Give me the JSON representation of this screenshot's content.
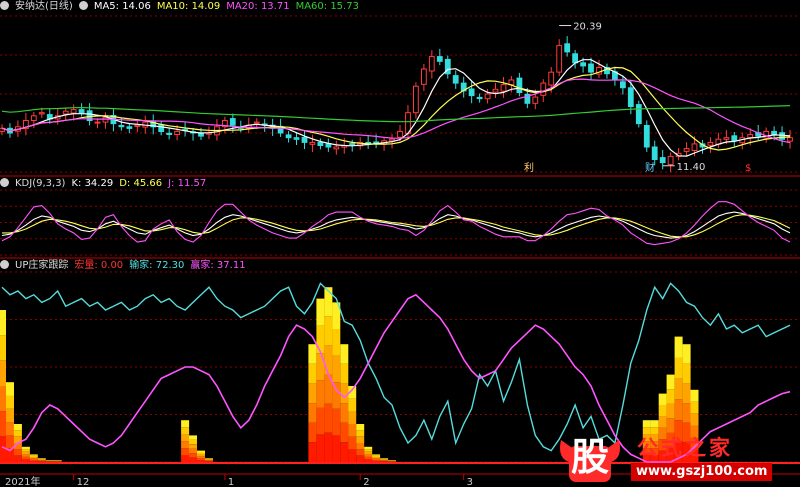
{
  "panel1": {
    "stock_name": "安纳达(日线)",
    "ma5": {
      "label": "MA5: 14.06",
      "color": "#ffffff"
    },
    "ma10": {
      "label": "MA10: 14.09",
      "color": "#ffff55"
    },
    "ma20": {
      "label": "MA20: 13.71",
      "color": "#ff55ff"
    },
    "ma60": {
      "label": "MA60: 15.73",
      "color": "#33cc33"
    },
    "high_label": "20.39",
    "low_label": "11.40",
    "events": [
      {
        "text": "利",
        "color": "#ffcc66"
      },
      {
        "text": "财",
        "color": "#66ccff"
      },
      {
        "text": "$",
        "color": "#ff3333"
      }
    ]
  },
  "panel2": {
    "indicator": "KDJ(9,3,3)",
    "k": {
      "label": "K: 34.29",
      "color": "#ffffff"
    },
    "d": {
      "label": "D: 45.66",
      "color": "#ffff55"
    },
    "j": {
      "label": "J: 11.57",
      "color": "#ff55ff"
    }
  },
  "panel3": {
    "indicator": "UP庄家跟踪",
    "s1": {
      "label": "宏量: 0.00",
      "color": "#ff3333"
    },
    "s2": {
      "label": "输家: 72.30",
      "color": "#55dddd"
    },
    "s3": {
      "label": "赢家: 37.11",
      "color": "#ff55ff"
    }
  },
  "xaxis": {
    "ticks": [
      {
        "label": "2021年",
        "bar": 0
      },
      {
        "label": "12",
        "bar": 9
      },
      {
        "label": "1",
        "bar": 28
      },
      {
        "label": "2",
        "bar": 45
      },
      {
        "label": "3",
        "bar": 58
      }
    ]
  },
  "watermark": {
    "logo_char": "股",
    "title": "公式之家",
    "url": "www.gszj100.com"
  },
  "chart_data": [
    {
      "type": "candlestick",
      "title": "安纳达(日线)",
      "y_range": [
        11.0,
        21.0
      ],
      "close": [
        13.8,
        13.5,
        13.9,
        14.3,
        14.6,
        14.8,
        14.4,
        14.6,
        14.9,
        15.0,
        14.8,
        14.3,
        14.2,
        14.5,
        14.1,
        13.9,
        13.8,
        14.0,
        14.2,
        13.9,
        13.6,
        13.4,
        13.6,
        13.7,
        13.5,
        13.3,
        13.5,
        13.9,
        14.3,
        14.0,
        13.8,
        14.0,
        14.2,
        14.0,
        13.8,
        13.5,
        13.2,
        13.1,
        12.9,
        12.9,
        12.7,
        12.6,
        12.6,
        12.7,
        12.8,
        12.9,
        12.8,
        12.9,
        13.0,
        13.1,
        13.6,
        14.8,
        16.5,
        17.6,
        18.4,
        18.1,
        17.3,
        16.7,
        16.2,
        15.9,
        15.7,
        16.0,
        16.3,
        16.6,
        16.9,
        16.1,
        15.4,
        15.8,
        16.7,
        17.4,
        19.1,
        18.7,
        18.0,
        17.8,
        17.4,
        17.7,
        17.3,
        16.9,
        16.4,
        15.2,
        14.1,
        12.6,
        11.8,
        11.6,
        12.0,
        12.2,
        12.5,
        12.8,
        12.6,
        12.9,
        13.1,
        13.2,
        13.0,
        13.2,
        13.4,
        13.3,
        13.6,
        13.4,
        13.1,
        13.2
      ],
      "high": 20.39,
      "low": 11.4
    },
    {
      "type": "line",
      "title": "KDJ(9,3,3)",
      "y_range": [
        0,
        100
      ],
      "series": [
        {
          "name": "K",
          "values": [
            30,
            32,
            38,
            46,
            55,
            60,
            58,
            52,
            48,
            44,
            38,
            36,
            40,
            48,
            52,
            46,
            40,
            34,
            32,
            38,
            42,
            46,
            40,
            34,
            30,
            32,
            40,
            50,
            58,
            62,
            60,
            56,
            52,
            48,
            44,
            40,
            36,
            34,
            36,
            40,
            44,
            50,
            54,
            56,
            58,
            56,
            54,
            52,
            50,
            48,
            46,
            44,
            40,
            42,
            48,
            56,
            62,
            60,
            56,
            54,
            50,
            46,
            42,
            38,
            36,
            34,
            30,
            28,
            30,
            34,
            40,
            46,
            50,
            54,
            58,
            60,
            58,
            56,
            52,
            46,
            40,
            34,
            30,
            28,
            26,
            27,
            30,
            36,
            44,
            52,
            60,
            64,
            66,
            64,
            60,
            56,
            52,
            48,
            40,
            34
          ]
        },
        {
          "name": "D",
          "values": [
            34,
            34,
            36,
            40,
            46,
            52,
            55,
            54,
            52,
            49,
            45,
            41,
            40,
            43,
            47,
            47,
            45,
            41,
            37,
            37,
            39,
            42,
            42,
            39,
            35,
            33,
            35,
            41,
            48,
            54,
            57,
            57,
            55,
            52,
            49,
            45,
            41,
            38,
            37,
            38,
            40,
            44,
            48,
            51,
            54,
            55,
            55,
            54,
            52,
            50,
            49,
            47,
            45,
            44,
            46,
            50,
            55,
            57,
            57,
            55,
            53,
            50,
            47,
            43,
            40,
            37,
            34,
            31,
            30,
            31,
            34,
            38,
            43,
            47,
            51,
            55,
            57,
            57,
            55,
            52,
            47,
            42,
            37,
            33,
            29,
            28,
            28,
            31,
            36,
            42,
            49,
            55,
            60,
            62,
            61,
            59,
            56,
            53,
            47,
            41
          ]
        },
        {
          "name": "J",
          "values": [
            22,
            28,
            42,
            58,
            74,
            76,
            64,
            48,
            40,
            34,
            24,
            26,
            40,
            58,
            62,
            44,
            30,
            20,
            22,
            40,
            48,
            54,
            36,
            24,
            20,
            30,
            50,
            68,
            78,
            78,
            66,
            54,
            46,
            40,
            34,
            30,
            26,
            26,
            34,
            44,
            52,
            62,
            66,
            66,
            66,
            58,
            52,
            48,
            46,
            44,
            40,
            38,
            30,
            38,
            52,
            68,
            76,
            66,
            54,
            52,
            44,
            38,
            32,
            28,
            28,
            28,
            22,
            22,
            30,
            40,
            52,
            62,
            64,
            68,
            72,
            70,
            60,
            54,
            46,
            34,
            26,
            18,
            16,
            18,
            20,
            25,
            34,
            46,
            60,
            72,
            82,
            82,
            78,
            68,
            58,
            50,
            44,
            38,
            26,
            20
          ]
        }
      ]
    },
    {
      "type": "line",
      "title": "UP庄家跟踪",
      "y_range": [
        0,
        100
      ],
      "series": [
        {
          "name": "宏量",
          "values": [
            80,
            42,
            20,
            8,
            4,
            2,
            1,
            1,
            0,
            0,
            0,
            0,
            0,
            0,
            0,
            0,
            0,
            0,
            0,
            0,
            0,
            0,
            0,
            22,
            14,
            6,
            2,
            0,
            0,
            0,
            0,
            0,
            0,
            0,
            0,
            0,
            0,
            0,
            0,
            62,
            86,
            92,
            84,
            62,
            40,
            20,
            8,
            4,
            2,
            1,
            0,
            0,
            0,
            0,
            0,
            0,
            0,
            0,
            0,
            0,
            0,
            0,
            0,
            0,
            0,
            0,
            0,
            0,
            0,
            0,
            0,
            0,
            0,
            0,
            0,
            0,
            0,
            0,
            0,
            0,
            0,
            22,
            22,
            36,
            46,
            66,
            62,
            38,
            0,
            0,
            0,
            0,
            0,
            0,
            0,
            0,
            0,
            0,
            0,
            0
          ]
        },
        {
          "name": "输家",
          "values": [
            92,
            88,
            90,
            86,
            88,
            84,
            86,
            90,
            82,
            84,
            86,
            82,
            84,
            80,
            82,
            84,
            80,
            82,
            86,
            88,
            84,
            86,
            82,
            80,
            84,
            88,
            92,
            86,
            82,
            80,
            76,
            78,
            80,
            82,
            86,
            90,
            92,
            82,
            78,
            84,
            94,
            90,
            86,
            74,
            72,
            64,
            52,
            44,
            34,
            30,
            18,
            10,
            14,
            22,
            12,
            24,
            32,
            10,
            20,
            28,
            46,
            40,
            48,
            32,
            42,
            54,
            30,
            14,
            8,
            6,
            12,
            20,
            30,
            18,
            24,
            12,
            14,
            10,
            30,
            52,
            64,
            80,
            92,
            86,
            94,
            90,
            84,
            82,
            76,
            72,
            78,
            70,
            72,
            68,
            70,
            72,
            66,
            68,
            70,
            72
          ]
        },
        {
          "name": "赢家",
          "values": [
            8,
            6,
            10,
            12,
            18,
            26,
            30,
            28,
            24,
            20,
            16,
            12,
            10,
            8,
            10,
            14,
            20,
            26,
            32,
            38,
            44,
            46,
            48,
            50,
            50,
            48,
            46,
            40,
            32,
            24,
            18,
            22,
            30,
            40,
            48,
            56,
            66,
            72,
            70,
            66,
            58,
            46,
            38,
            34,
            38,
            44,
            52,
            60,
            68,
            74,
            80,
            86,
            88,
            84,
            80,
            76,
            70,
            62,
            54,
            48,
            44,
            46,
            48,
            54,
            60,
            64,
            68,
            72,
            70,
            66,
            62,
            56,
            50,
            46,
            40,
            30,
            22,
            14,
            8,
            4,
            2,
            0,
            0,
            0,
            0,
            2,
            4,
            8,
            12,
            16,
            18,
            20,
            22,
            24,
            26,
            30,
            32,
            34,
            36,
            37
          ]
        }
      ]
    }
  ]
}
